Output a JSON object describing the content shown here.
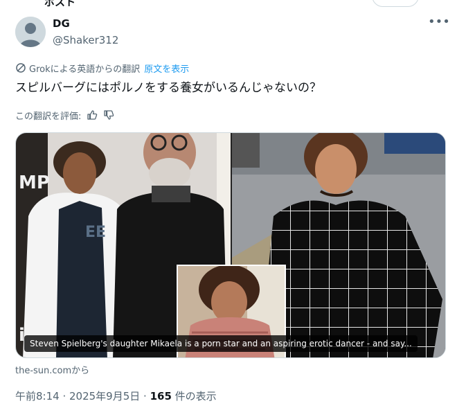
{
  "top_bar": {
    "partial_text": "ポスト"
  },
  "author": {
    "name": "DG",
    "handle": "@Shaker312"
  },
  "more_icon": "more-horizontal-icon",
  "translation": {
    "note": "Grokによる英語からの翻訳",
    "show_original": "原文を表示",
    "rate_label": "この翻訳を評価:"
  },
  "tweet": {
    "text": "スピルバーグにはポルノをする養女がいるんじゃないの？"
  },
  "card": {
    "caption": "Steven Spielberg's daughter Mikaela is a porn star and an aspiring erotic dancer - and say...",
    "source": "the-sun.comから"
  },
  "meta": {
    "time": "午前8:14",
    "separator": " · ",
    "date": "2025年9月5日",
    "views_count": "165",
    "views_label": " 件の表示"
  },
  "colors": {
    "accent": "#1d9bf0",
    "secondary_text": "#536471",
    "primary_text": "#0f1419",
    "border": "#cfd9de"
  }
}
